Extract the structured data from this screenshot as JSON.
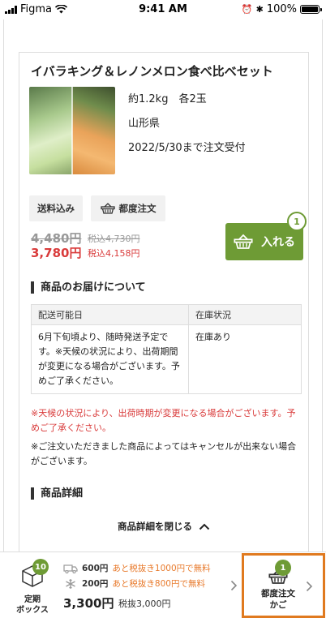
{
  "status_bar": {
    "carrier": "Figma",
    "time": "9:41 AM",
    "battery": "100%",
    "battery_level": 1.0
  },
  "product": {
    "title": "イバラキング＆レノンメロン食べ比べセット",
    "specs": [
      "約1.2kg　各2玉",
      "山形県",
      "2022/5/30まで注文受付"
    ],
    "tags": [
      "送料込み",
      "都度注文"
    ],
    "old_price": "4,480円",
    "old_price_tax": "税込4,730円",
    "price": "3,780円",
    "price_tax": "税込4,158円",
    "cart_button_label": "入れる",
    "cart_count": "1"
  },
  "delivery": {
    "heading": "商品のお届けについて",
    "columns": [
      "配送可能日",
      "在庫状況"
    ],
    "rows": [
      [
        "6月下旬頃より、随時発送予定です。※天候の状況により、出荷期間が変更になる場合がございます。予めご了承ください。",
        "在庫あり"
      ]
    ],
    "note_red": "※天候の状況により、出荷時期が変更になる場合がございます。予めご了承ください。",
    "note_black": "※ご注文いただきました商品によってはキャンセルが出来ない場合がございます。"
  },
  "details": {
    "heading": "商品詳細",
    "collapse_label": "商品詳細を閉じる"
  },
  "bottom_bar": {
    "subscription_label_1": "定期",
    "subscription_label_2": "ボックス",
    "subscription_count": "10",
    "shipping_lines": [
      {
        "icon": "truck-icon",
        "amount": "600円",
        "message": "あと税抜き1000円で無料"
      },
      {
        "icon": "snowflake-icon",
        "amount": "200円",
        "message": "あと税抜き800円で無料"
      }
    ],
    "total": "3,300円",
    "total_tax": "税抜3,000円",
    "order_cart_label_1": "都度注文",
    "order_cart_label_2": "かご",
    "order_cart_count": "1"
  },
  "colors": {
    "accent_green": "#6e9b35",
    "sale_red": "#d93b3b",
    "highlight_orange": "#e07a1f",
    "shipping_msg_orange": "#e87a2c"
  }
}
